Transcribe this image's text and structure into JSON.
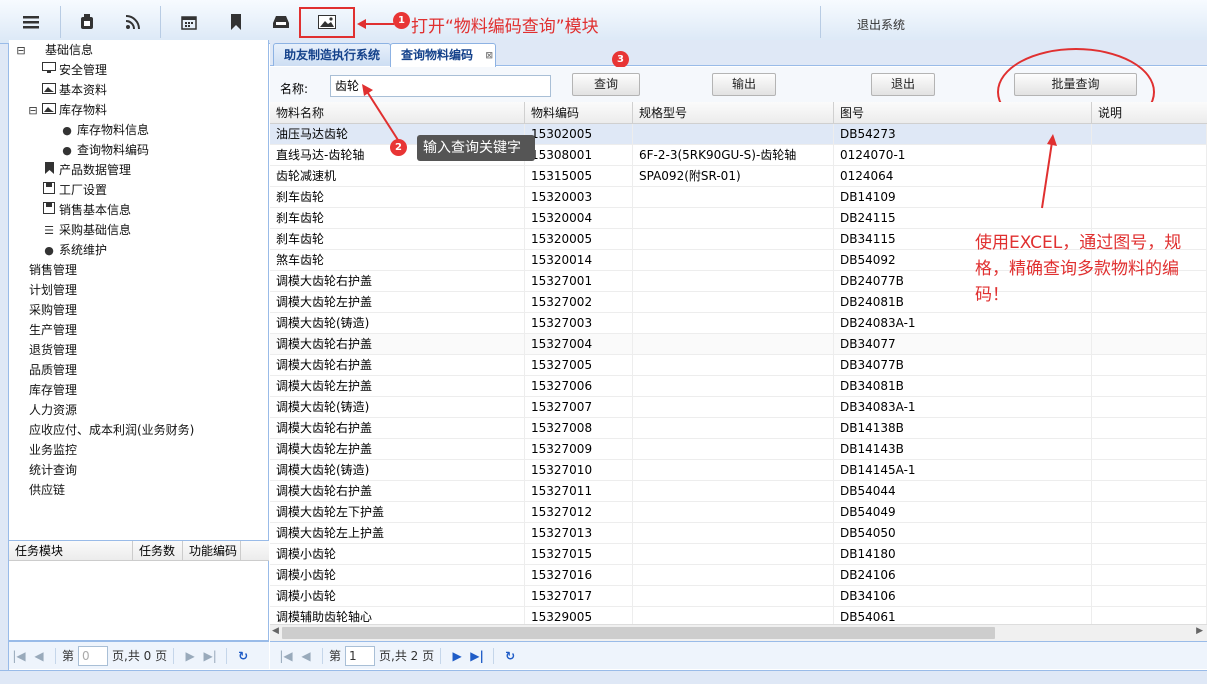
{
  "toolbar": {
    "icons": [
      "menu-icon",
      "phone-icon",
      "rss-icon",
      "calendar-icon",
      "bookmark-icon",
      "inbox-icon",
      "image-icon"
    ],
    "logout": "退出系统"
  },
  "annotations": {
    "step1_text": "打开“物料编码查询”模块",
    "step2_text": "输入查询关键字",
    "note": "使用EXCEL，通过图号，规格，精确查询多款物料的编码！",
    "badge1": "1",
    "badge2": "2",
    "badge3": "3",
    "accent_color": "#e03030"
  },
  "sidebar": {
    "root": "基础信息",
    "items": [
      {
        "label": "安全管理",
        "icon": "monitor-icon"
      },
      {
        "label": "基本资料",
        "icon": "image-icon"
      },
      {
        "label": "库存物料",
        "icon": "image-icon"
      },
      {
        "label": "库存物料信息",
        "icon": "user-icon"
      },
      {
        "label": "查询物料编码",
        "icon": "user-icon"
      },
      {
        "label": "产品数据管理",
        "icon": "bookmark-icon"
      },
      {
        "label": "工厂设置",
        "icon": "save-icon"
      },
      {
        "label": "销售基本信息",
        "icon": "save-icon"
      },
      {
        "label": "采购基础信息",
        "icon": "list-icon"
      },
      {
        "label": "系统维护",
        "icon": "user-icon"
      }
    ],
    "modules": [
      "销售管理",
      "计划管理",
      "采购管理",
      "生产管理",
      "退货管理",
      "品质管理",
      "库存管理",
      "人力资源",
      "应收应付、成本利润(业务财务)",
      "业务监控",
      "统计查询",
      "供应链"
    ]
  },
  "task_panel": {
    "col_module": "任务模块",
    "col_count": "任务数",
    "col_code": "功能编码"
  },
  "left_pager": {
    "page_label": "第",
    "page_value": "0",
    "total": "页,共 0 页"
  },
  "tabs": [
    {
      "label": "助友制造执行系统"
    },
    {
      "label": "查询物料编码"
    }
  ],
  "search": {
    "name_label": "名称:",
    "name_value": "齿轮",
    "query_btn": "查询",
    "export_btn": "输出",
    "exit_btn": "退出",
    "batch_btn": "批量查询"
  },
  "grid": {
    "headers": [
      "物料名称",
      "物料编码",
      "规格型号",
      "图号",
      "说明"
    ],
    "rows": [
      [
        "油压马达齿轮",
        "15302005",
        "",
        "DB54273",
        ""
      ],
      [
        "直线马达-齿轮轴",
        "15308001",
        "6F-2-3(5RK90GU-S)-齿轮轴",
        "0124070-1",
        ""
      ],
      [
        "齿轮减速机",
        "15315005",
        "SPA092(附SR-01)",
        "0124064",
        ""
      ],
      [
        "刹车齿轮",
        "15320003",
        "",
        "DB14109",
        ""
      ],
      [
        "刹车齿轮",
        "15320004",
        "",
        "DB24115",
        ""
      ],
      [
        "刹车齿轮",
        "15320005",
        "",
        "DB34115",
        ""
      ],
      [
        "煞车齿轮",
        "15320014",
        "",
        "DB54092",
        ""
      ],
      [
        "调模大齿轮右护盖",
        "15327001",
        "",
        "DB24077B",
        ""
      ],
      [
        "调模大齿轮左护盖",
        "15327002",
        "",
        "DB24081B",
        ""
      ],
      [
        "调模大齿轮(铸造)",
        "15327003",
        "",
        "DB24083A-1",
        ""
      ],
      [
        "调模大齿轮右护盖",
        "15327004",
        "",
        "DB34077",
        ""
      ],
      [
        "调模大齿轮右护盖",
        "15327005",
        "",
        "DB34077B",
        ""
      ],
      [
        "调模大齿轮左护盖",
        "15327006",
        "",
        "DB34081B",
        ""
      ],
      [
        "调模大齿轮(铸造)",
        "15327007",
        "",
        "DB34083A-1",
        ""
      ],
      [
        "调模大齿轮右护盖",
        "15327008",
        "",
        "DB14138B",
        ""
      ],
      [
        "调模大齿轮左护盖",
        "15327009",
        "",
        "DB14143B",
        ""
      ],
      [
        "调模大齿轮(铸造)",
        "15327010",
        "",
        "DB14145A-1",
        ""
      ],
      [
        "调模大齿轮右护盖",
        "15327011",
        "",
        "DB54044",
        ""
      ],
      [
        "调模大齿轮左下护盖",
        "15327012",
        "",
        "DB54049",
        ""
      ],
      [
        "调模大齿轮左上护盖",
        "15327013",
        "",
        "DB54050",
        ""
      ],
      [
        "调模小齿轮",
        "15327015",
        "",
        "DB14180",
        ""
      ],
      [
        "调模小齿轮",
        "15327016",
        "",
        "DB24106",
        ""
      ],
      [
        "调模小齿轮",
        "15327017",
        "",
        "DB34106",
        ""
      ],
      [
        "调模辅助齿轮轴心",
        "15329005",
        "",
        "DB54061",
        ""
      ]
    ]
  },
  "main_pager": {
    "page_label": "第",
    "page_value": "1",
    "total": "页,共 2 页"
  }
}
